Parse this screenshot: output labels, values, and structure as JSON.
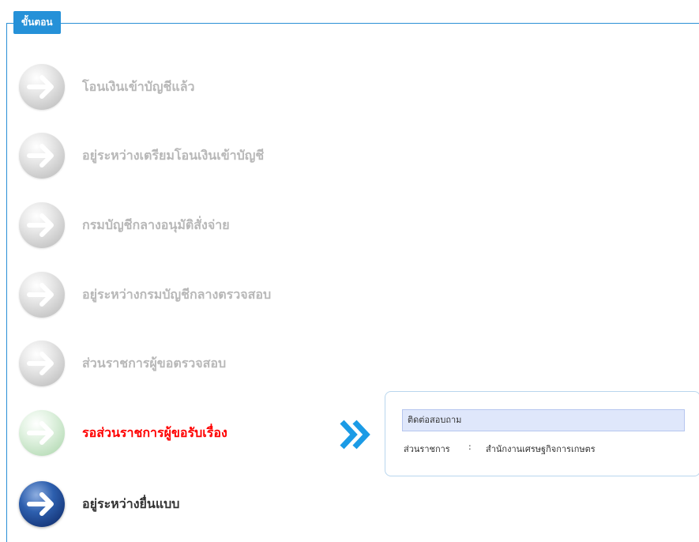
{
  "section": {
    "legend": "ขั้นตอน"
  },
  "steps": [
    {
      "label": "โอนเงินเข้าบัญชีแล้ว",
      "state": "inactive"
    },
    {
      "label": "อยู่ระหว่างเตรียมโอนเงินเข้าบัญชี",
      "state": "inactive"
    },
    {
      "label": "กรมบัญชีกลางอนุมัติสั่งจ่าย",
      "state": "inactive"
    },
    {
      "label": "อยู่ระหว่างกรมบัญชีกลางตรวจสอบ",
      "state": "inactive"
    },
    {
      "label": "ส่วนราชการผู้ขอตรวจสอบ",
      "state": "inactive"
    },
    {
      "label": "รอส่วนราชการผู้ขอรับเรื่อง",
      "state": "current"
    },
    {
      "label": "อยู่ระหว่างยื่นแบบ",
      "state": "completed"
    }
  ],
  "contact": {
    "title": "ติดต่อสอบถาม",
    "agency_label": "ส่วนราชการ",
    "colon": ":",
    "agency_value": "สำนักงานเศรษฐกิจการเกษตร"
  },
  "colors": {
    "accent": "#2591d8",
    "current_text": "#ff0000",
    "inactive_text": "#b8b8b8",
    "completed_text": "#333333"
  },
  "icons": {
    "step": "arrow-right-circle-icon",
    "pointer": "double-chevron-right-icon"
  }
}
